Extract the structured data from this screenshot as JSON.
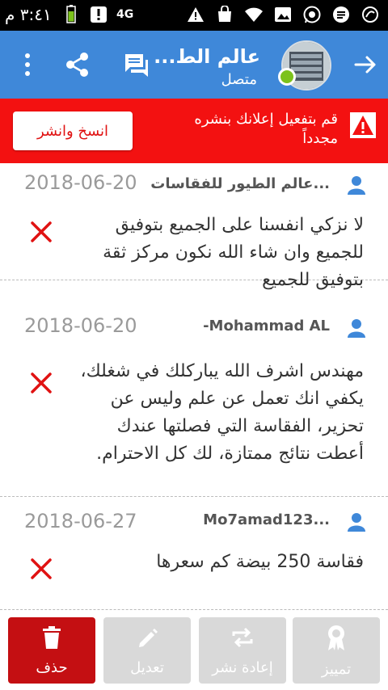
{
  "status_bar": {
    "time": "٣:٤١ م",
    "network": "4G"
  },
  "app_bar": {
    "title": "عالم الط...",
    "subtitle": "متصل",
    "status_color": "#7cc21b",
    "background": "#3f88d9"
  },
  "banner": {
    "message": "قم بتفعيل إعلانك بنشره مجدداً",
    "button_label": "انسخ وانشر",
    "background": "#f31111"
  },
  "comments": [
    {
      "name": "عالم الطيور للفقاسات...",
      "date": "2018-06-20",
      "body": "لا نزكي انفسنا على الجميع  بتوفيق للجميع وان شاء الله نكون مركز ثقة بتوفيق للجميع"
    },
    {
      "name": "-Mohammad AL",
      "date": "2018-06-20",
      "body": "مهندس اشرف الله يباركلك في شغلك، يكفي انك تعمل عن علم وليس عن تحزير، الفقاسة التي فصلتها عندك أعطت نتائج ممتازة، لك كل الاحترام."
    },
    {
      "name": "Mo7amad123...",
      "date": "2018-06-27",
      "body": "فقاسة 250 بيضة كم سعرها"
    }
  ],
  "bottom_bar": {
    "feature_label": "تمييز",
    "repost_label": "إعادة نشر",
    "edit_label": "تعديل",
    "delete_label": "حذف",
    "delete_color": "#c40f12"
  }
}
